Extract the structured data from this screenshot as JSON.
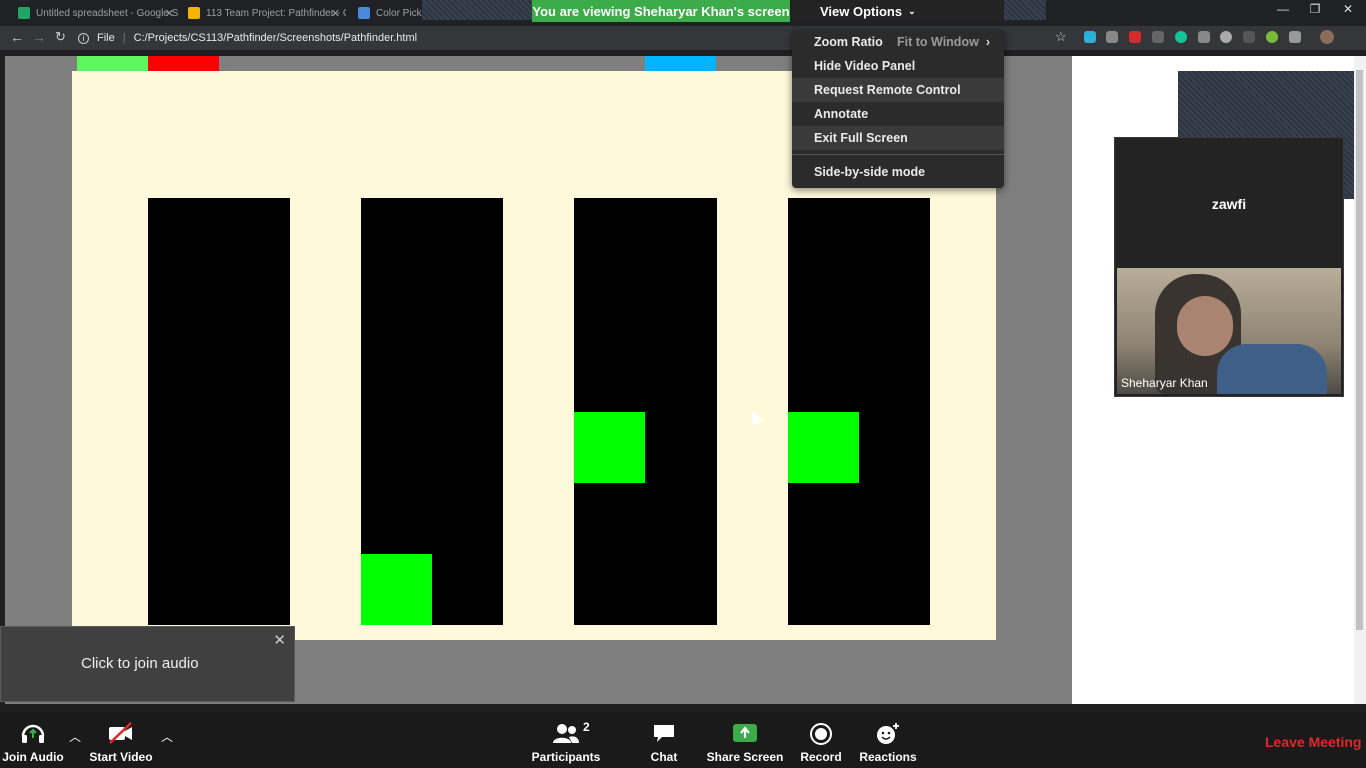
{
  "browser": {
    "tabs": [
      {
        "title": "Untitled spreadsheet - Google S",
        "fav_color": "#1fa463"
      },
      {
        "title": "113 Team Project: Pathfinder - G",
        "fav_color": "#f4b400"
      },
      {
        "title": "Color Pick",
        "fav_color": "#4a89dc"
      }
    ],
    "url_scheme": "File",
    "url": "C:/Projects/CS113/Pathfinder/Screenshots/Pathfinder.html"
  },
  "zoom": {
    "viewing_banner": "You are viewing Sheharyar Khan's screen",
    "view_options_label": "View Options",
    "menu": {
      "zoom_ratio": "Zoom Ratio",
      "zoom_ratio_value": "Fit to Window",
      "hide_video_panel": "Hide Video Panel",
      "request_remote_control": "Request Remote Control",
      "annotate": "Annotate",
      "exit_full_screen": "Exit Full Screen",
      "side_by_side": "Side-by-side mode"
    },
    "video_panel": {
      "participant_name": "zawfi",
      "speaker_label": "Sheharyar Khan"
    },
    "audio_toast": "Click to join audio",
    "toolbar": {
      "join_audio": "Join Audio",
      "start_video": "Start Video",
      "participants": "Participants",
      "participants_count": "2",
      "chat": "Chat",
      "share_screen": "Share Screen",
      "record": "Record",
      "reactions": "Reactions",
      "leave": "Leave Meeting"
    }
  },
  "pathfinder": {
    "colors": {
      "palette_green": "#5df75d",
      "palette_red": "#ff0000",
      "palette_blue": "#00b4ff",
      "wall": "#000000",
      "path": "#00ff00",
      "background": "#fff9dc",
      "border": "#7f7f7f"
    }
  }
}
